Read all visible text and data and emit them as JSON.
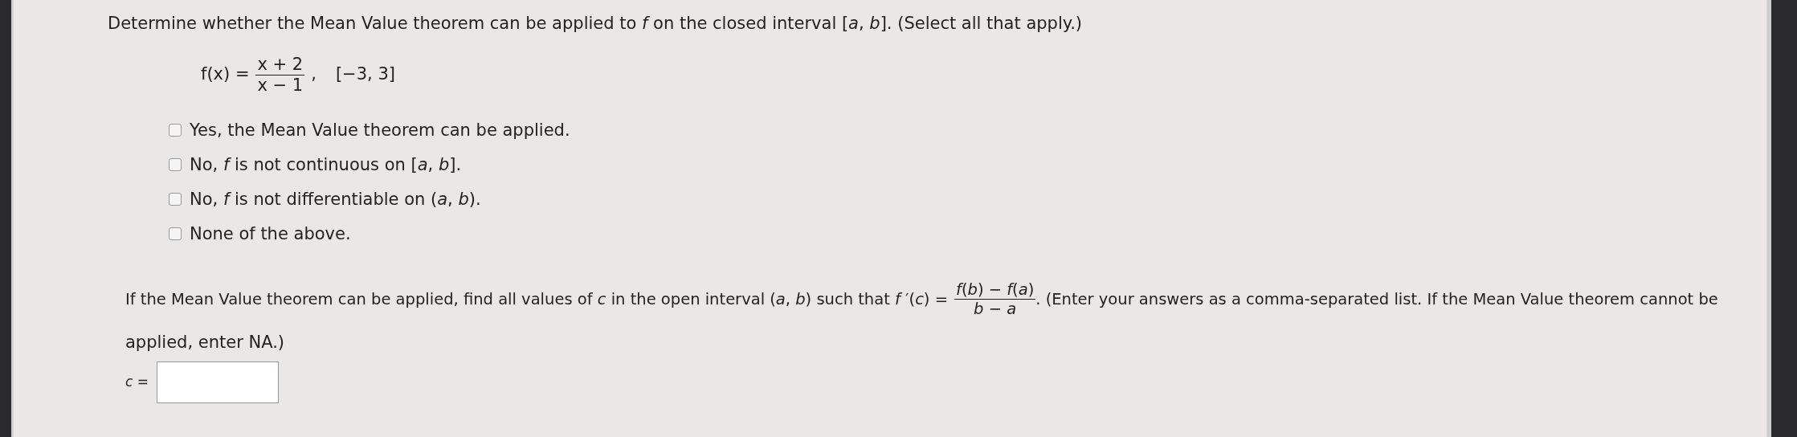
{
  "question": "Determine whether the Mean Value theorem can be applied to *f* on the closed interval [*a*, *b*]. (Select all that apply.)",
  "function": {
    "label": "f(x) =",
    "numerator": "x + 2",
    "denominator": "x − 1",
    "separator": ",",
    "interval": "[−3, 3]"
  },
  "options": [
    {
      "text": "Yes, the Mean Value theorem can be applied.",
      "checked": false
    },
    {
      "text": "No, *f* is not continuous on [*a*, *b*].",
      "checked": false
    },
    {
      "text": "No, *f* is not differentiable on (*a*, *b*).",
      "checked": false
    },
    {
      "text": "None of the above.",
      "checked": false
    }
  ],
  "instruction": {
    "before": "If the Mean Value theorem can be applied, find all values of *c* in the open interval (*a*, *b*) such that *f* ′(*c*) =",
    "numerator": "*f*(*b*) − *f*(*a*)",
    "denominator": "*b* − *a*",
    "after": ". (Enter your answers as a comma-separated list. If the Mean Value theorem cannot be",
    "continuation": "applied, enter NA.)"
  },
  "answer": {
    "label": "*c* ="
  }
}
